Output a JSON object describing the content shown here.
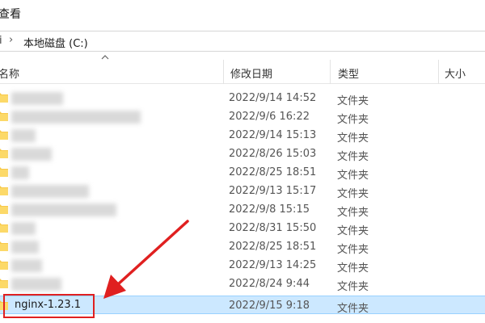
{
  "menu": {
    "view_label": "查看"
  },
  "address": {
    "prefix": "i",
    "chevron": "›",
    "path": "本地磁盘 (C:)"
  },
  "columns": {
    "name": "名称",
    "date": "修改日期",
    "type": "类型",
    "size": "大小"
  },
  "files": [
    {
      "name": "",
      "date": "2022/9/14 14:52",
      "type": "文件夹"
    },
    {
      "name": "",
      "date": "2022/9/6 16:22",
      "type": "文件夹"
    },
    {
      "name": "",
      "date": "2022/9/14 15:13",
      "type": "文件夹"
    },
    {
      "name": "",
      "date": "2022/8/26 15:03",
      "type": "文件夹"
    },
    {
      "name": "",
      "date": "2022/8/25 18:51",
      "type": "文件夹"
    },
    {
      "name": "",
      "date": "2022/9/13 15:17",
      "type": "文件夹"
    },
    {
      "name": "",
      "date": "2022/9/8 15:15",
      "type": "文件夹"
    },
    {
      "name": "",
      "date": "2022/8/31 15:50",
      "type": "文件夹"
    },
    {
      "name": "",
      "date": "2022/8/25 18:51",
      "type": "文件夹"
    },
    {
      "name": "",
      "date": "2022/9/13 14:25",
      "type": "文件夹"
    },
    {
      "name": "",
      "date": "2022/8/24 9:44",
      "type": "文件夹"
    },
    {
      "name": "nginx-1.23.1",
      "date": "2022/9/15 9:18",
      "type": "文件夹"
    }
  ],
  "icons": {
    "folder": "folder-icon",
    "sort": "sort-ascending-icon",
    "annotation": "red-arrow"
  },
  "colors": {
    "folder": "#f8c94a",
    "selection": "#cce8ff",
    "annotation": "#e02020"
  }
}
